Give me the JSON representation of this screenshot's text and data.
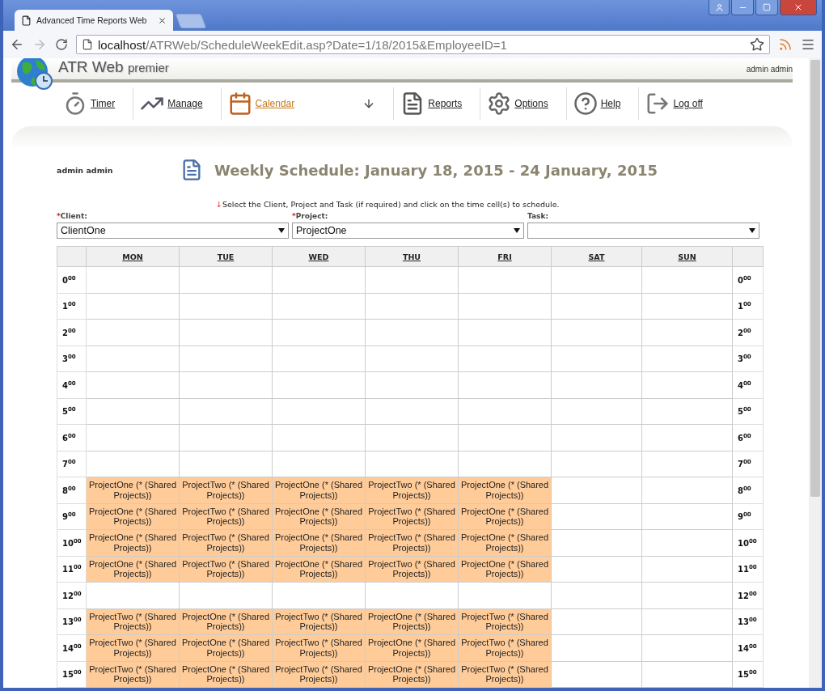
{
  "browser": {
    "tab_title": "Advanced Time Reports Web",
    "url_host": "localhost",
    "url_path": "/ATRWeb/ScheduleWeekEdit.asp?Date=1/18/2015&EmployeeID=1"
  },
  "header": {
    "app_name": "ATR Web",
    "edition": "premier",
    "user": "admin admin"
  },
  "nav": [
    {
      "kind": "link",
      "label": "Timer",
      "selected": false
    },
    {
      "kind": "link",
      "label": "Manage",
      "selected": false
    },
    {
      "kind": "link",
      "label": "Calendar",
      "selected": true
    },
    {
      "kind": "download"
    },
    {
      "kind": "link",
      "label": "Reports",
      "selected": false
    },
    {
      "kind": "link",
      "label": "Options",
      "selected": false
    },
    {
      "kind": "link",
      "label": "Help",
      "selected": false
    },
    {
      "kind": "link",
      "label": "Log off",
      "selected": false
    }
  ],
  "page": {
    "user": "admin admin",
    "title": "Weekly Schedule: January 18, 2015 - 24 January, 2015",
    "hint_arrow": "↓",
    "instruction": "Select the Client, Project and Task (if required) and click on the time cell(s) to schedule."
  },
  "filters": [
    {
      "label": "Client:",
      "mark": "*",
      "value": "ClientOne"
    },
    {
      "label": "Project:",
      "mark": "*",
      "value": "ProjectOne"
    },
    {
      "label": "Task:"
    }
  ],
  "schedule": {
    "days": [
      "MON",
      "TUE",
      "WED",
      "THU",
      "FRI",
      "SAT",
      "SUN"
    ],
    "rows": [
      {
        "left": "0$^{00}$",
        "right": "0$^{00}$",
        "cells": [
          null,
          null,
          null,
          null,
          null,
          null,
          null
        ]
      },
      {
        "left": "1$^{00}$",
        "right": "1$^{00}$",
        "cells": [
          null,
          null,
          null,
          null,
          null,
          null,
          null
        ]
      },
      {
        "left": "2$^{00}$",
        "right": "2$^{00}$",
        "cells": [
          null,
          null,
          null,
          null,
          null,
          null,
          null
        ]
      },
      {
        "left": "3$^{00}$",
        "right": "3$^{00}$",
        "cells": [
          null,
          null,
          null,
          null,
          null,
          null,
          null
        ]
      },
      {
        "left": "4$^{00}$",
        "right": "4$^{00}$",
        "cells": [
          null,
          null,
          null,
          null,
          null,
          null,
          null
        ]
      },
      {
        "left": "5$^{00}$",
        "right": "5$^{00}$",
        "cells": [
          null,
          null,
          null,
          null,
          null,
          null,
          null
        ]
      },
      {
        "left": "6$^{00}$",
        "right": "6$^{00}$",
        "cells": [
          null,
          null,
          null,
          null,
          null,
          null,
          null
        ]
      },
      {
        "left": "7$^{00}$",
        "right": "7$^{00}$",
        "cells": [
          null,
          null,
          null,
          null,
          null,
          null,
          null
        ]
      },
      {
        "left": "8$^{00}$",
        "right": "8$^{00}$",
        "cells": [
          "ProjectOne (* (Shared Projects))",
          "ProjectTwo (* (Shared Projects))",
          "ProjectOne (* (Shared Projects))",
          "ProjectTwo (* (Shared Projects))",
          "ProjectOne (* (Shared Projects))",
          null,
          null
        ]
      },
      {
        "left": "9$^{00}$",
        "right": "9$^{00}$",
        "cells": [
          "ProjectOne (* (Shared Projects))",
          "ProjectTwo (* (Shared Projects))",
          "ProjectOne (* (Shared Projects))",
          "ProjectTwo (* (Shared Projects))",
          "ProjectOne (* (Shared Projects))",
          null,
          null
        ]
      },
      {
        "left": "10$^{00}$",
        "right": "10$^{00}$",
        "cells": [
          "ProjectOne (* (Shared Projects))",
          "ProjectTwo (* (Shared Projects))",
          "ProjectOne (* (Shared Projects))",
          "ProjectTwo (* (Shared Projects))",
          "ProjectOne (* (Shared Projects))",
          null,
          null
        ]
      },
      {
        "left": "11$^{00}$",
        "right": "11$^{00}$",
        "cells": [
          "ProjectOne (* (Shared Projects))",
          "ProjectTwo (* (Shared Projects))",
          "ProjectOne (* (Shared Projects))",
          "ProjectTwo (* (Shared Projects))",
          "ProjectOne (* (Shared Projects))",
          null,
          null
        ]
      },
      {
        "left": "12$^{00}$",
        "right": "12$^{00}$",
        "cells": [
          null,
          null,
          null,
          null,
          null,
          null,
          null
        ]
      },
      {
        "left": "13$^{00}$",
        "right": "13$^{00}$",
        "cells": [
          "ProjectTwo (* (Shared Projects))",
          "ProjectOne (* (Shared Projects))",
          "ProjectTwo (* (Shared Projects))",
          "ProjectOne (* (Shared Projects))",
          "ProjectTwo (* (Shared Projects))",
          null,
          null
        ]
      },
      {
        "left": "14$^{00}$",
        "right": "14$^{00}$",
        "cells": [
          "ProjectTwo (* (Shared Projects))",
          "ProjectOne (* (Shared Projects))",
          "ProjectTwo (* (Shared Projects))",
          "ProjectOne (* (Shared Projects))",
          "ProjectTwo (* (Shared Projects))",
          null,
          null
        ]
      },
      {
        "left": "15$^{00}$",
        "right": "15$^{00}$",
        "cells": [
          "ProjectTwo (* (Shared Projects))",
          "ProjectOne (* (Shared Projects))",
          "ProjectTwo (* (Shared Projects))",
          "ProjectOne (* (Shared Projects))",
          "ProjectTwo (* (Shared Projects))",
          null,
          null
        ]
      }
    ]
  }
}
